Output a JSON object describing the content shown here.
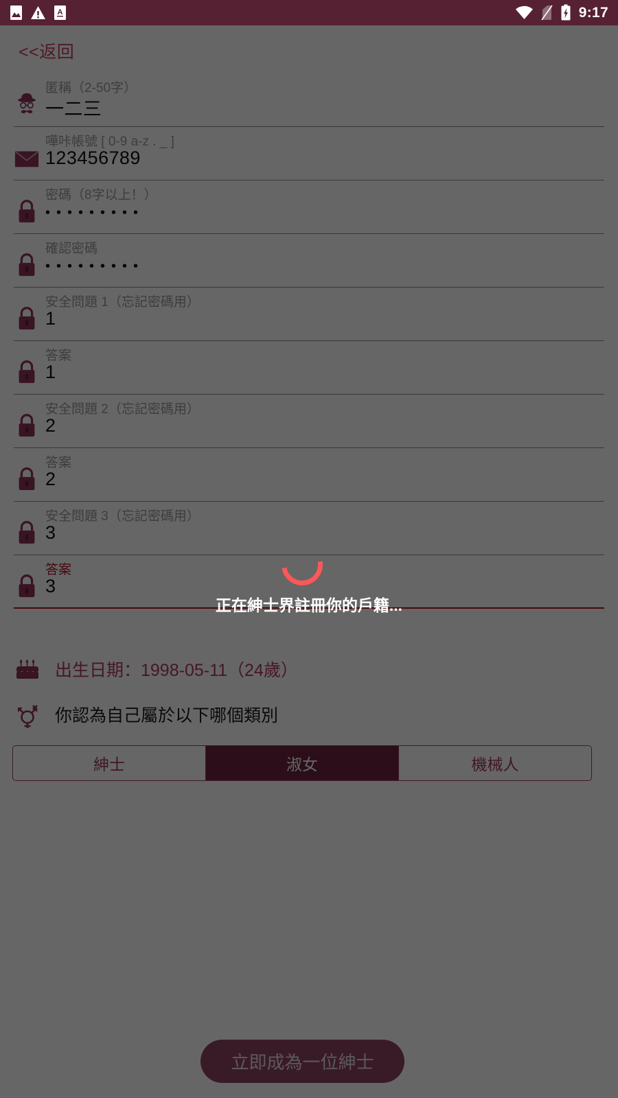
{
  "status_bar": {
    "time": "9:17",
    "left_icons": [
      "image-icon",
      "warning-icon",
      "font-a-icon"
    ],
    "right_icons": [
      "wifi-icon",
      "no-sim-icon",
      "battery-charging-icon"
    ],
    "background_color": "#552133"
  },
  "nav": {
    "back_label": "<<返回",
    "back_color": "#c8415f"
  },
  "form": {
    "fields": [
      {
        "label": "匿稱（2-50字）",
        "value": "一二三",
        "icon": "gentleman-avatar-icon",
        "type": "text",
        "focused": false
      },
      {
        "label": "嘩咔帳號 [ 0-9 a-z . _ ]",
        "value": "123456789",
        "icon": "envelope-icon",
        "type": "text",
        "focused": false
      },
      {
        "label": "密碼（8字以上！）",
        "value": "•••••••••",
        "icon": "lock-icon",
        "type": "password",
        "focused": false
      },
      {
        "label": "確認密碼",
        "value": "•••••••••",
        "icon": "lock-icon",
        "type": "password",
        "focused": false
      },
      {
        "label": "安全問題 1（忘記密碼用）",
        "value": "1",
        "icon": "lock-icon",
        "type": "text",
        "focused": false
      },
      {
        "label": "答案",
        "value": "1",
        "icon": "lock-icon",
        "type": "text",
        "focused": false
      },
      {
        "label": "安全問題 2（忘記密碼用）",
        "value": "2",
        "icon": "lock-icon",
        "type": "text",
        "focused": false
      },
      {
        "label": "答案",
        "value": "2",
        "icon": "lock-icon",
        "type": "text",
        "focused": false
      },
      {
        "label": "安全問題 3（忘記密碼用）",
        "value": "3",
        "icon": "lock-icon",
        "type": "text",
        "focused": false
      },
      {
        "label": "答案",
        "value": "3",
        "icon": "lock-icon",
        "type": "text",
        "focused": true
      }
    ]
  },
  "birthday": {
    "icon": "birthday-cake-icon",
    "text": "出生日期：1998-05-11（24歲）",
    "color": "#b03a5b"
  },
  "gender": {
    "icon": "transgender-icon",
    "question": "你認為自己屬於以下哪個類別",
    "options": [
      {
        "label": "紳士",
        "selected": false
      },
      {
        "label": "淑女",
        "selected": true
      },
      {
        "label": "機械人",
        "selected": false
      }
    ],
    "accent_color": "#a33c5e",
    "selected_fill": "#6b2440"
  },
  "submit": {
    "label": "立即成為一位紳士",
    "background_color": "#8e4463"
  },
  "loading": {
    "message": "正在紳士界註冊你的戶籍...",
    "spinner_color": "#ff5757",
    "scrim_opacity": "0.60"
  }
}
